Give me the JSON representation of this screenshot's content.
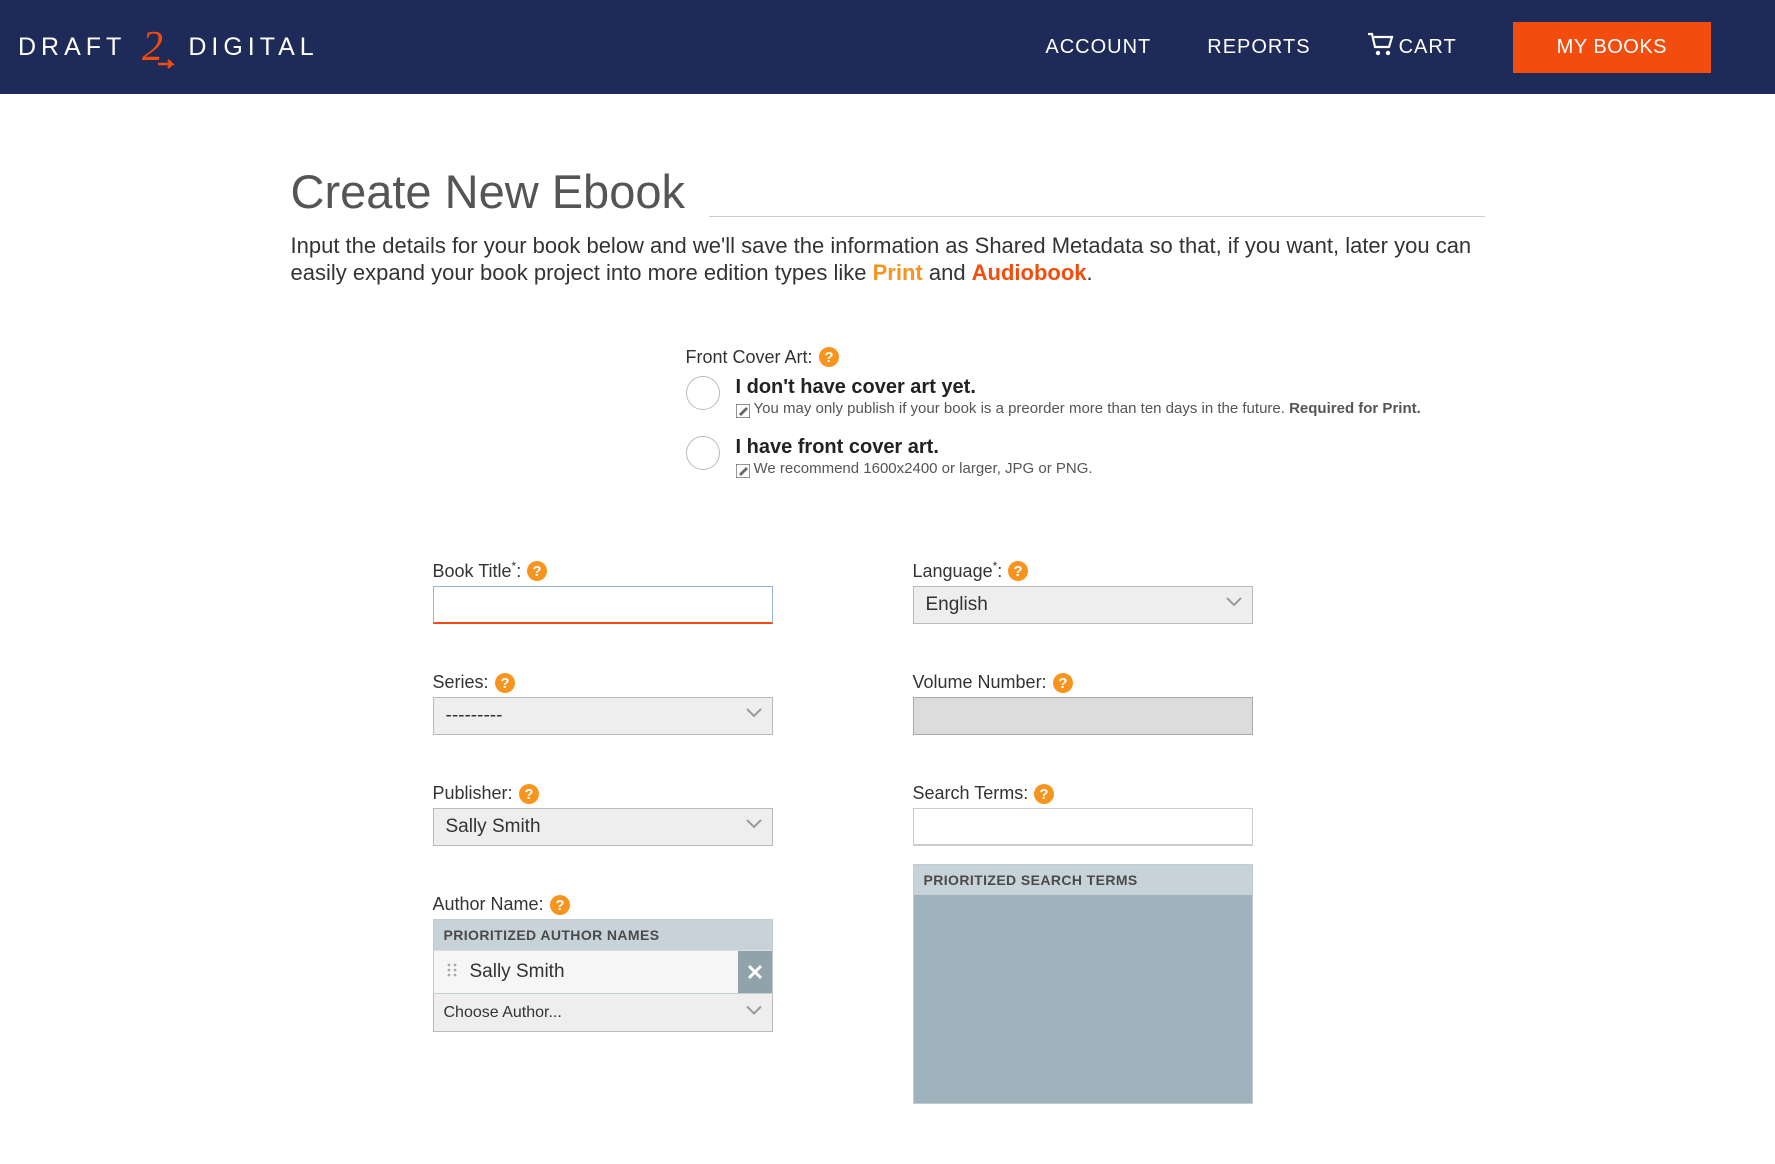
{
  "nav": {
    "account": "ACCOUNT",
    "reports": "REPORTS",
    "cart": "CART",
    "mybooks": "MY BOOKS"
  },
  "logo": {
    "left": "DRAFT",
    "right": "DIGITAL"
  },
  "page": {
    "title": "Create New Ebook",
    "intro_1": "Input the details for your book below and we'll save the information as Shared Metadata so that, if you want, later you can easily expand your book project into more edition types like ",
    "intro_print": "Print",
    "intro_and": " and ",
    "intro_audio": "Audiobook",
    "intro_end": "."
  },
  "cover": {
    "label": "Front Cover Art:",
    "opt1_title": "I don't have cover art yet.",
    "opt1_sub_a": "You may only publish if your book is a preorder more than ten days in the future. ",
    "opt1_sub_b": "Required for Print.",
    "opt2_title": "I have front cover art.",
    "opt2_sub": "We recommend 1600x2400 or larger, JPG or PNG."
  },
  "form": {
    "book_title_label": "Book Title",
    "language_label": "Language",
    "language_value": "English",
    "series_label": "Series:",
    "series_value": "---------",
    "volume_label": "Volume Number:",
    "publisher_label": "Publisher:",
    "publisher_value": "Sally Smith",
    "searchterms_label": "Search Terms:",
    "paneltitle_st": "PRIORITIZED SEARCH TERMS",
    "author_label": "Author Name:",
    "paneltitle_auth": "PRIORITIZED AUTHOR NAMES",
    "author_value": "Sally Smith",
    "choose_author": "Choose Author..."
  }
}
